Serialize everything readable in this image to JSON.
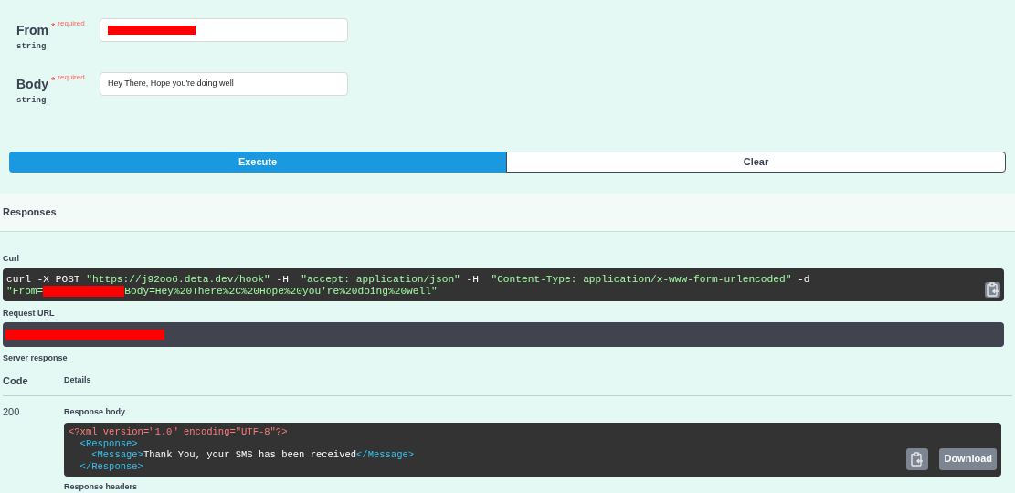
{
  "params": [
    {
      "name": "From",
      "required_mark": "*",
      "required_label": "required",
      "type": "string",
      "redacted": true
    },
    {
      "name": "Body",
      "required_mark": "*",
      "required_label": "required",
      "type": "string",
      "redacted": false,
      "value": "Hey There, Hope you're doing well"
    }
  ],
  "buttons": {
    "execute": "Execute",
    "clear": "Clear"
  },
  "responses": {
    "title": "Responses",
    "curl": {
      "label": "Curl",
      "lines": [
        [
          {
            "kind": "plain",
            "text": "curl -X POST "
          },
          {
            "kind": "string",
            "text": "\"https://j92oo6.deta.dev/hook\""
          },
          {
            "kind": "plain",
            "text": " -H  "
          },
          {
            "kind": "string",
            "text": "\"accept: application/json\""
          },
          {
            "kind": "plain",
            "text": " -H  "
          },
          {
            "kind": "string",
            "text": "\"Content-Type: application/x-www-form-urlencoded\""
          },
          {
            "kind": "plain",
            "text": " -d"
          }
        ],
        [
          {
            "kind": "string",
            "text": "\"From="
          },
          {
            "kind": "redaction"
          },
          {
            "kind": "string",
            "text": "Body=Hey%20There%2C%20Hope%20you're%20doing%20well\""
          }
        ]
      ]
    },
    "request_url": {
      "label": "Request URL",
      "redacted": true
    },
    "server_response_label": "Server response",
    "columns": [
      "Code",
      "Details"
    ],
    "rows": [
      {
        "code": "200",
        "body_label": "Response body",
        "body_decl": "<?xml version=\"1.0\" encoding=\"UTF-8\"?>",
        "body_tree": [
          {
            "open": "<Response>",
            "close": "</Response>",
            "children": [
              {
                "open": "<Message>",
                "text": "Thank You, your SMS has been received",
                "close": "</Message>"
              }
            ]
          }
        ],
        "download": "Download",
        "headers_label": "Response headers"
      }
    ]
  }
}
